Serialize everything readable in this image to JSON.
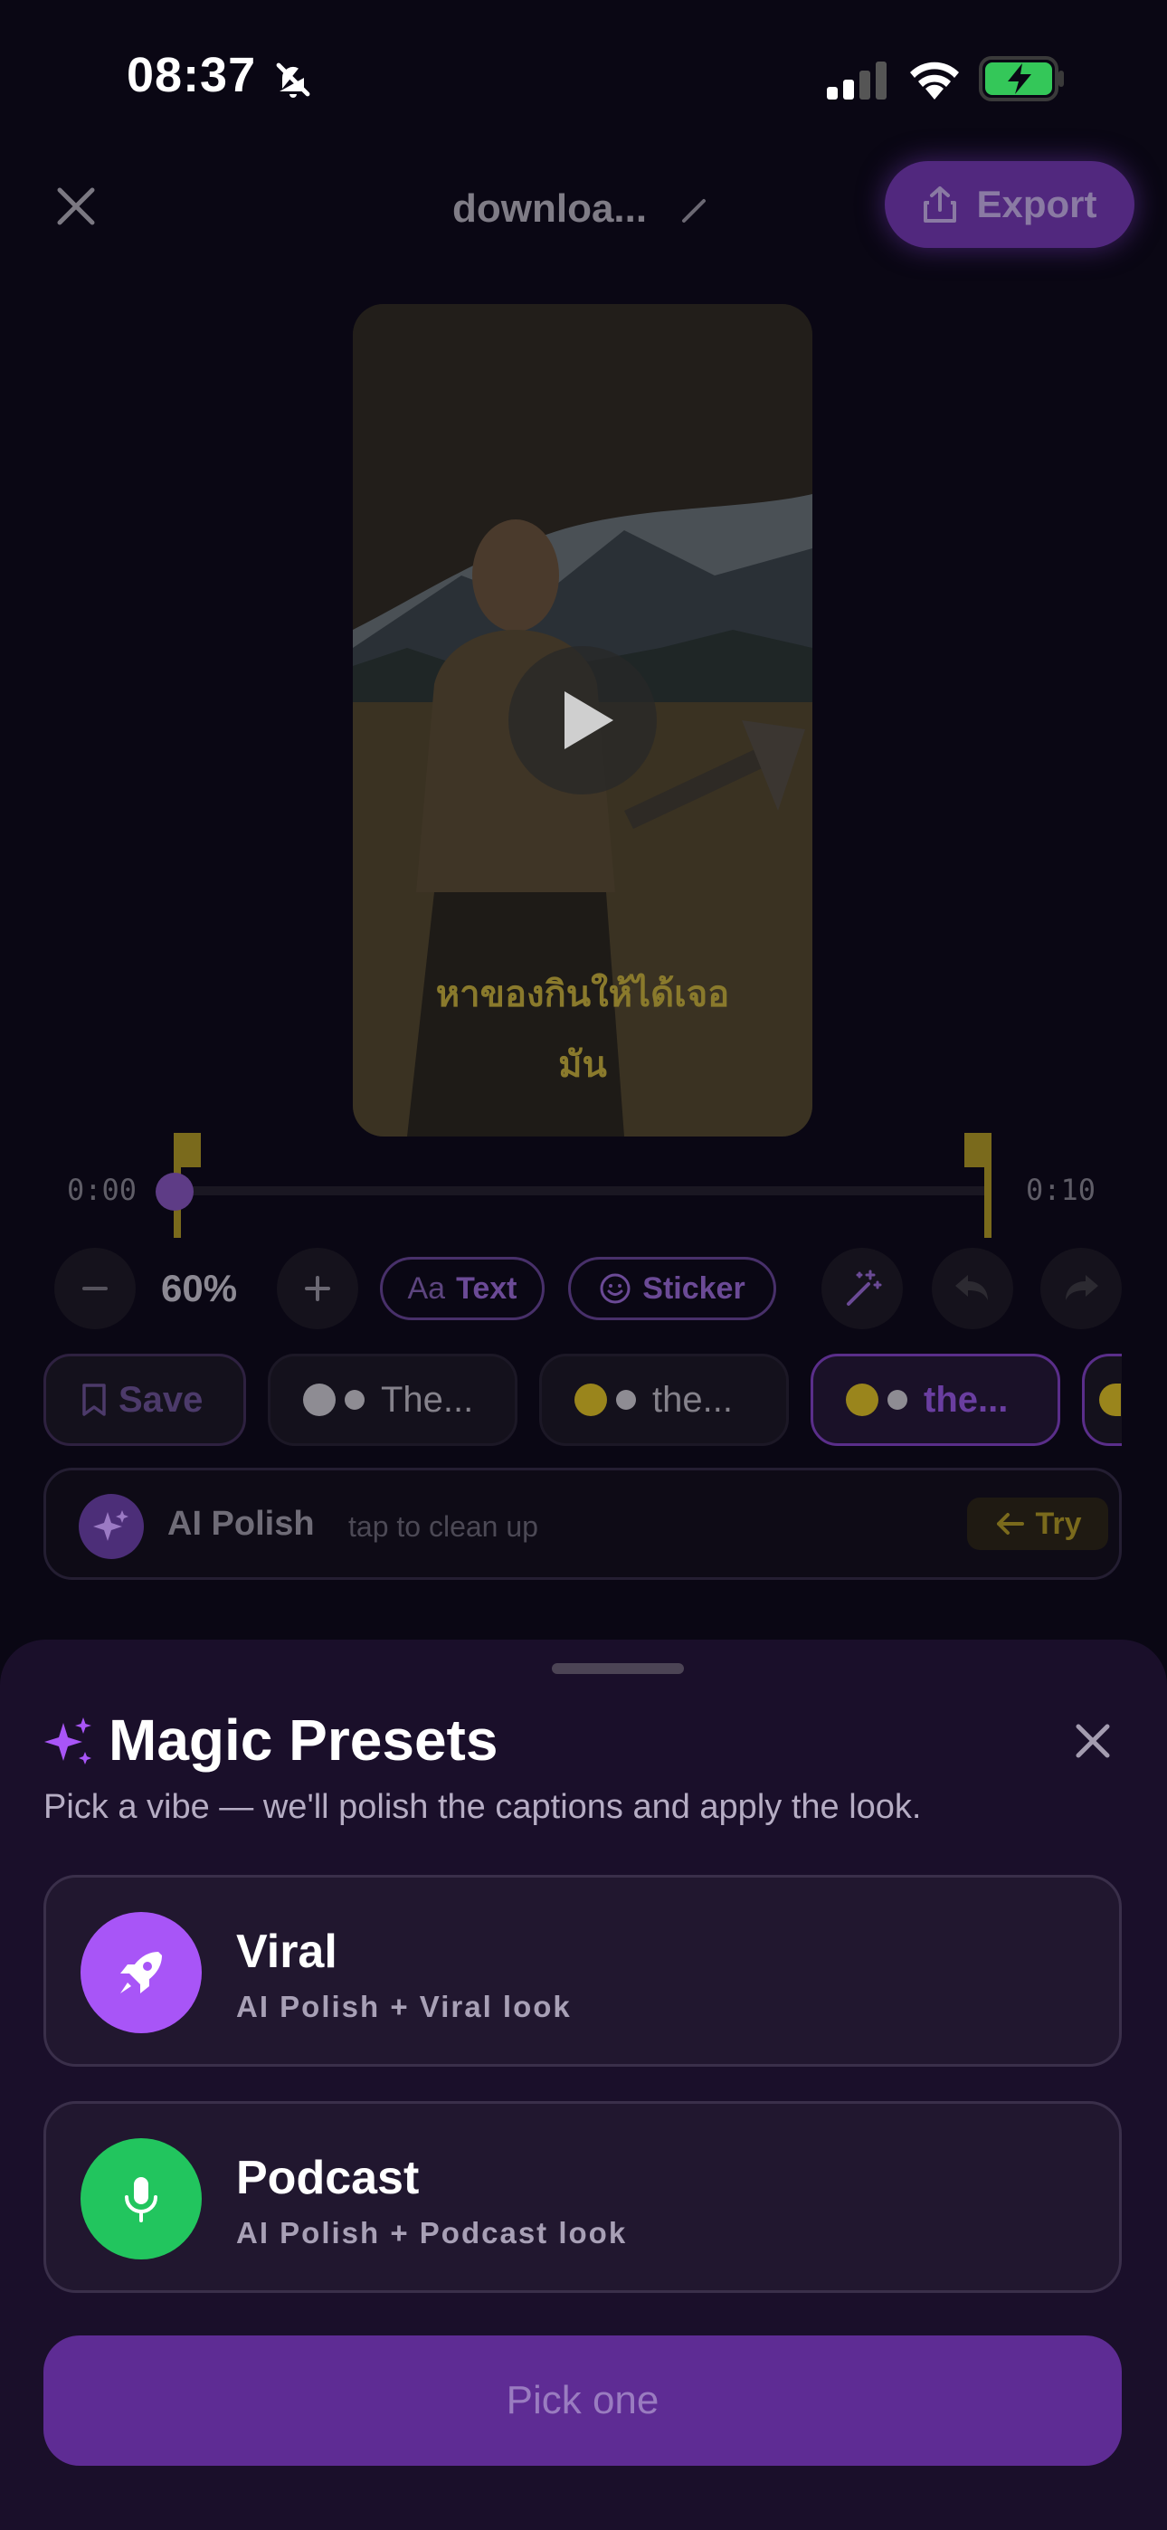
{
  "status_bar": {
    "time": "08:37"
  },
  "header": {
    "title": "downloa...",
    "export_label": "Export"
  },
  "video": {
    "caption_line1": "หาของกินให้ได้เจอ",
    "caption_line2": "มัน"
  },
  "timeline": {
    "start": "0:00",
    "end": "0:10"
  },
  "tools": {
    "zoom": "60%",
    "text_label": "Text",
    "sticker_label": "Sticker"
  },
  "chips": {
    "save_label": "Save",
    "items": [
      {
        "label": "The...",
        "dot_color": "#8e8c93",
        "selected": false
      },
      {
        "label": "the...",
        "dot_color": "#9a851c",
        "selected": false
      },
      {
        "label": "the...",
        "dot_color": "#9a851c",
        "selected": true
      }
    ]
  },
  "ai_polish": {
    "title": "AI Polish",
    "hint": "tap to clean up",
    "try_label": "Try"
  },
  "sheet": {
    "title": "Magic Presets",
    "subtitle": "Pick a vibe — we'll polish the captions and apply the look.",
    "presets": [
      {
        "name": "Viral",
        "desc": "AI Polish + Viral look",
        "icon": "rocket-icon",
        "color": "#a855f7"
      },
      {
        "name": "Podcast",
        "desc": "AI Polish + Podcast look",
        "icon": "microphone-icon",
        "color": "#22c55e"
      }
    ],
    "pick_label": "Pick one"
  },
  "colors": {
    "accent": "#7c3aed",
    "sheet_bg": "#1a0f2a",
    "gold": "#9a851c"
  }
}
